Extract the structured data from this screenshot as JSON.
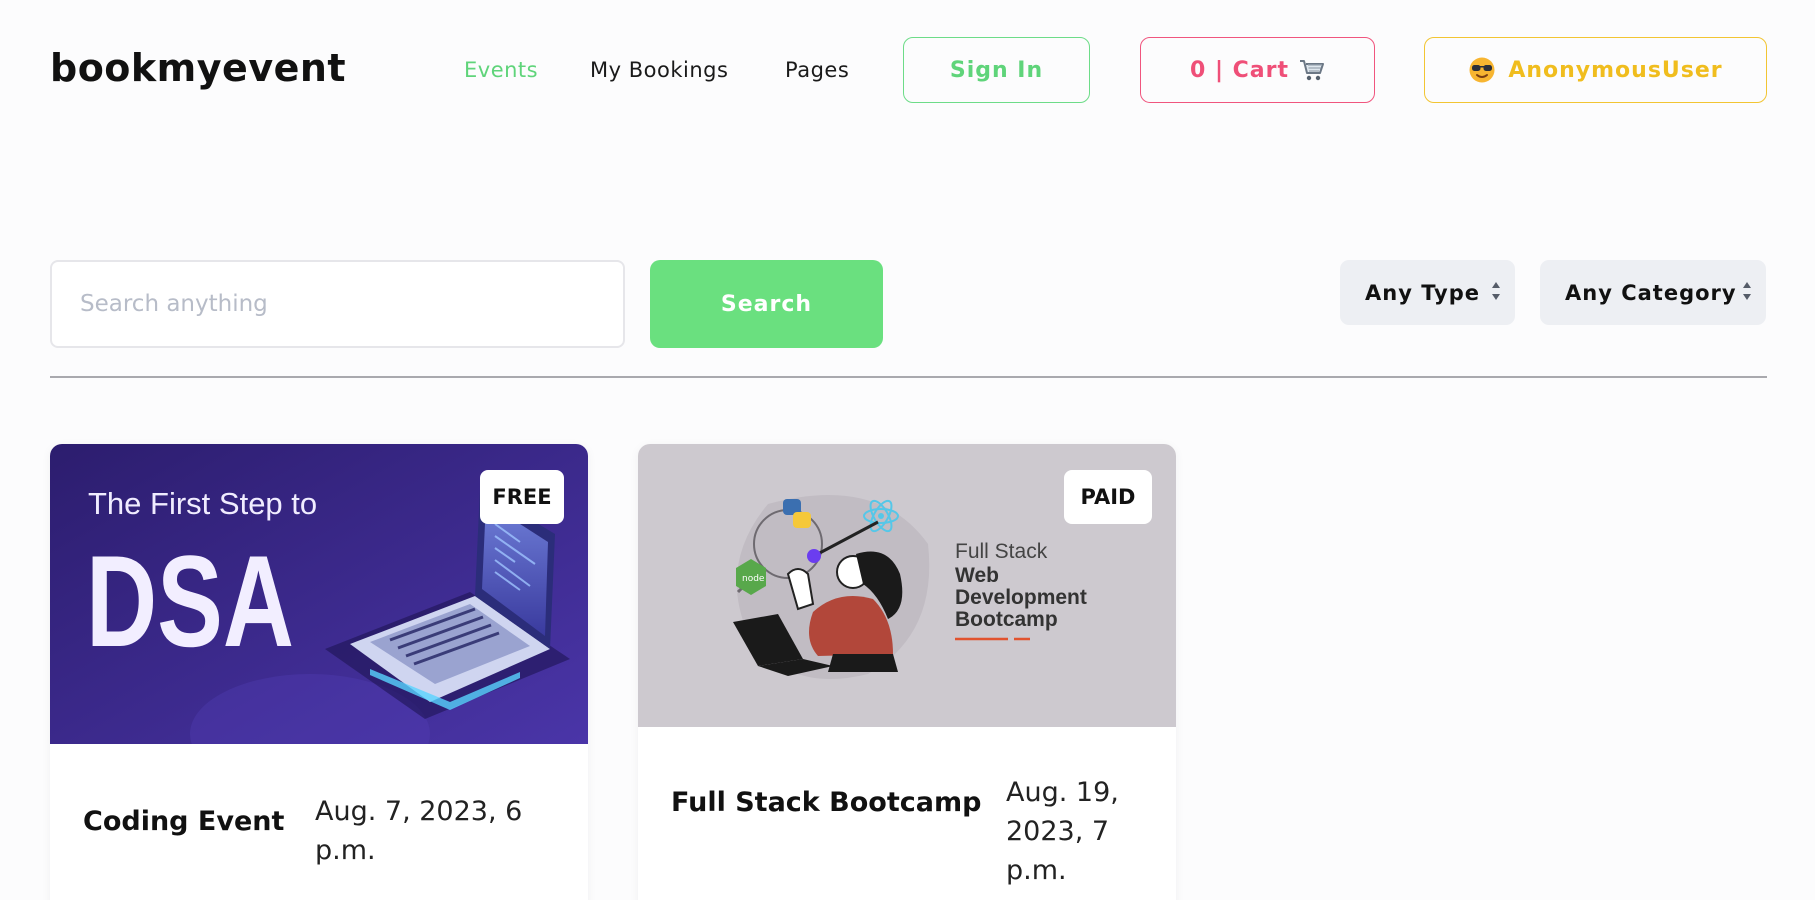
{
  "header": {
    "logo": "bookmyevent",
    "nav": [
      {
        "label": "Events",
        "active": true
      },
      {
        "label": "My Bookings",
        "active": false
      },
      {
        "label": "Pages",
        "active": false
      }
    ],
    "signin_label": "Sign In",
    "cart_label": "0 | Cart",
    "cart_icon": "shopping-cart-icon",
    "user_label": "AnonymousUser",
    "user_icon": "sunglasses-emoji-icon"
  },
  "search": {
    "placeholder": "Search anything",
    "value": "",
    "button_label": "Search"
  },
  "filters": {
    "type_selected": "Any Type",
    "category_selected": "Any Category"
  },
  "events": [
    {
      "title": "Coding Event",
      "date": "Aug. 7, 2023, 6 p.m.",
      "badge": "FREE",
      "image": {
        "line1": "The First Step to",
        "line2": "DSA"
      }
    },
    {
      "title": "Full Stack Bootcamp",
      "date": "Aug. 19, 2023, 7 p.m.",
      "badge": "PAID",
      "image": {
        "line1": "Full Stack",
        "line2": "Web",
        "line3": "Development",
        "line4": "Bootcamp",
        "node_label": "node"
      }
    }
  ],
  "colors": {
    "accent_green": "#6ae07f",
    "cart_pink": "#ef4f78",
    "user_yellow": "#f0bd1e"
  }
}
